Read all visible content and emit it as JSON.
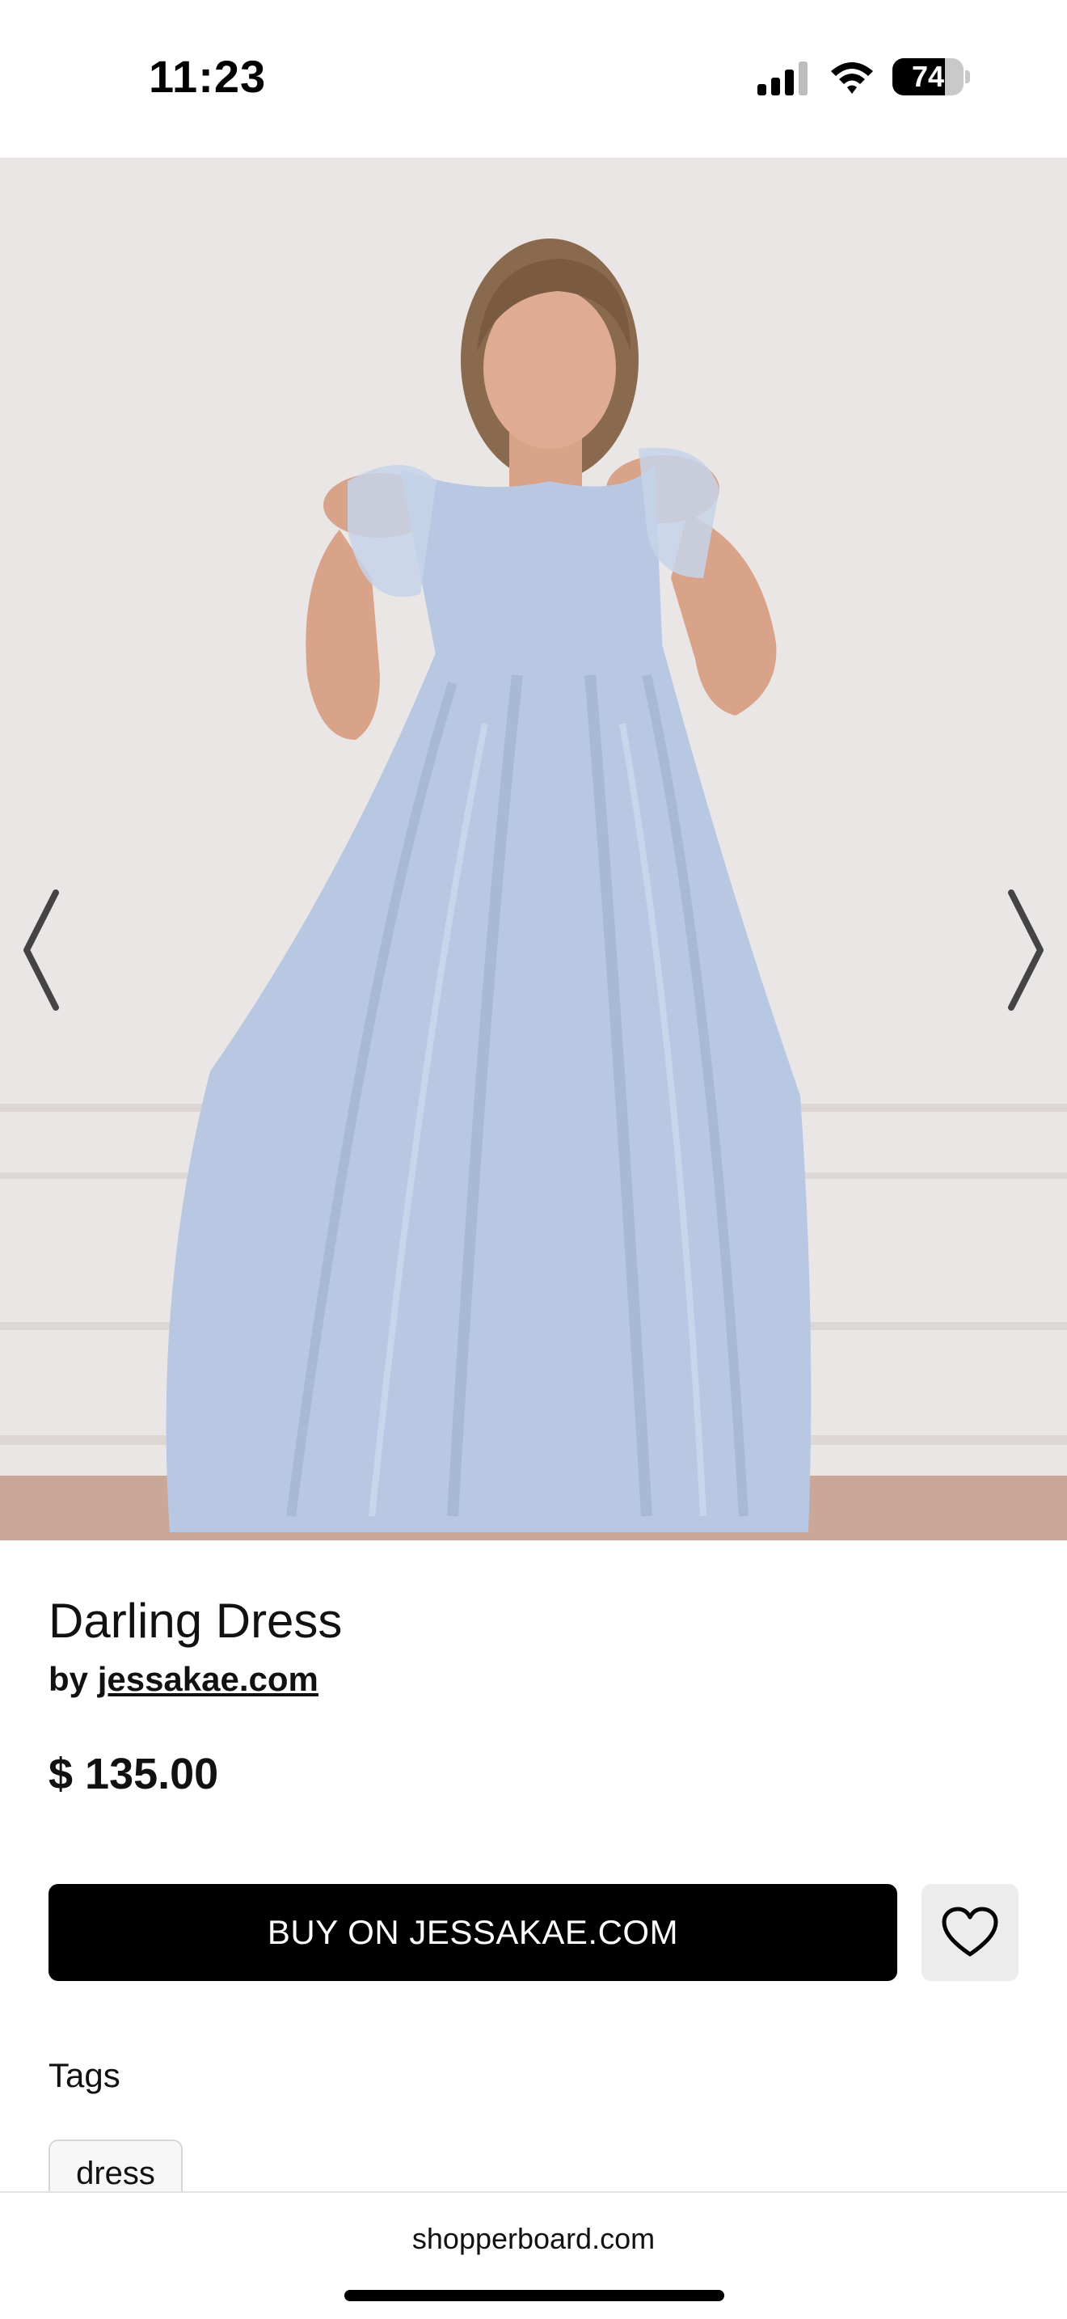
{
  "status_bar": {
    "time": "11:23",
    "battery_level": 74,
    "battery_label": "74",
    "icons": [
      "signal-icon",
      "wifi-icon",
      "battery-icon"
    ]
  },
  "product": {
    "image_alt": "",
    "title": "Darling Dress",
    "brand_prefix": "by",
    "brand": "jessakae.com",
    "price": "$ 135.00",
    "buy_label": "BUY ON JESSAKAE.COM",
    "favorite_icon": "heart-icon"
  },
  "carousel": {
    "prev_icon": "chevron-left-icon",
    "next_icon": "chevron-right-icon"
  },
  "tags": {
    "heading": "Tags",
    "items": [
      "dress"
    ]
  },
  "browser": {
    "url": "shopperboard.com"
  },
  "colors": {
    "dress": "#b8c8e2",
    "wall": "#ebe6e6",
    "floor": "#c9a89a",
    "button": "#000000",
    "favorite_bg": "#ececec"
  }
}
